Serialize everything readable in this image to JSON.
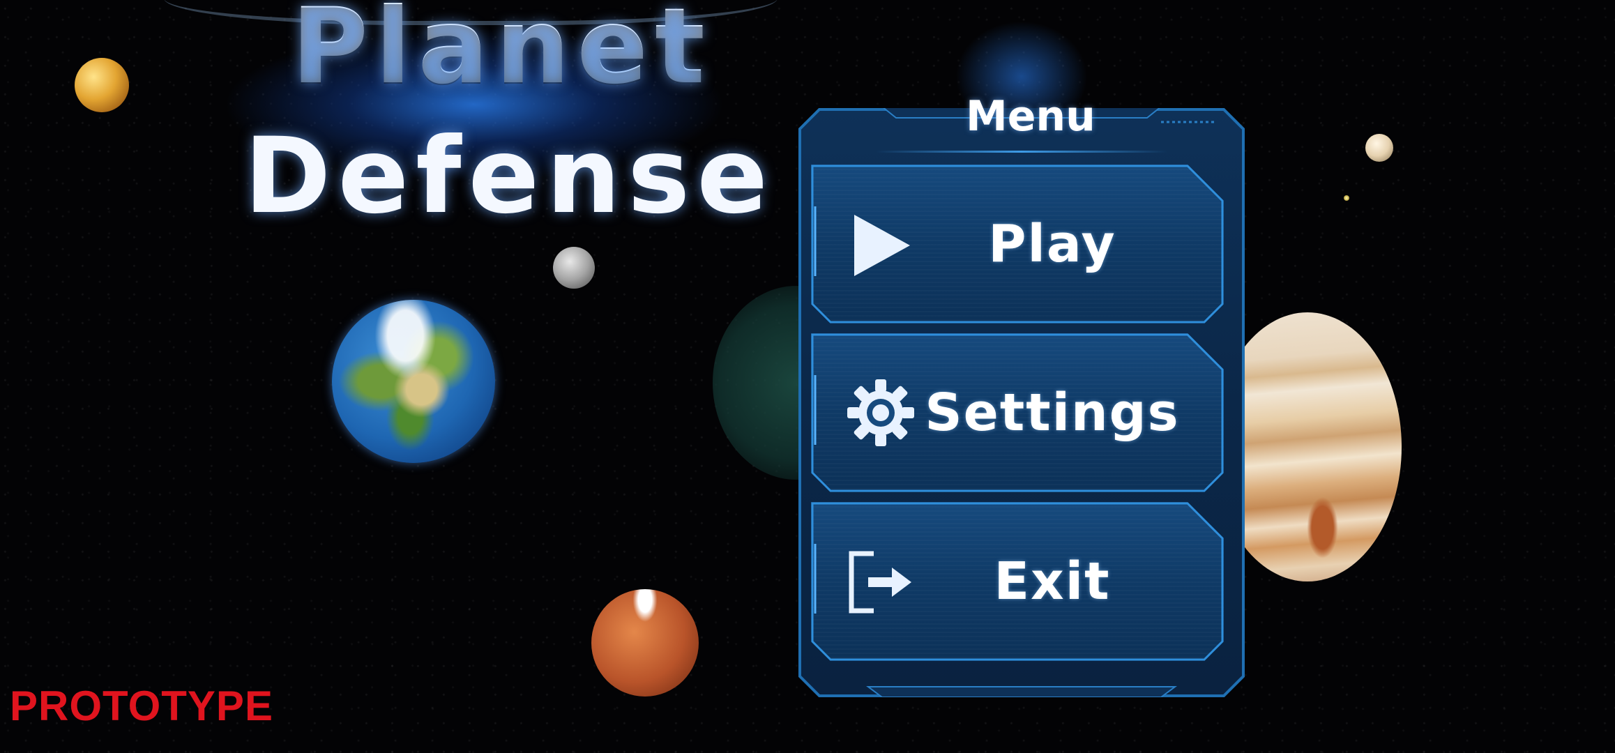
{
  "title": {
    "line1": "Planet",
    "line2": "Defense"
  },
  "menu": {
    "title": "Menu",
    "buttons": [
      {
        "label": "Play",
        "icon": "play-icon"
      },
      {
        "label": "Settings",
        "icon": "gear-icon"
      },
      {
        "label": "Exit",
        "icon": "exit-icon"
      }
    ]
  },
  "footer": {
    "build_label": "PROTOTYPE"
  },
  "colors": {
    "title_glow": "#2878e6",
    "panel_bg": "#0b2748",
    "panel_border": "#1f6fb2",
    "button_border": "#2f8fdc",
    "text": "#ffffff",
    "prototype": "#e0141e"
  }
}
